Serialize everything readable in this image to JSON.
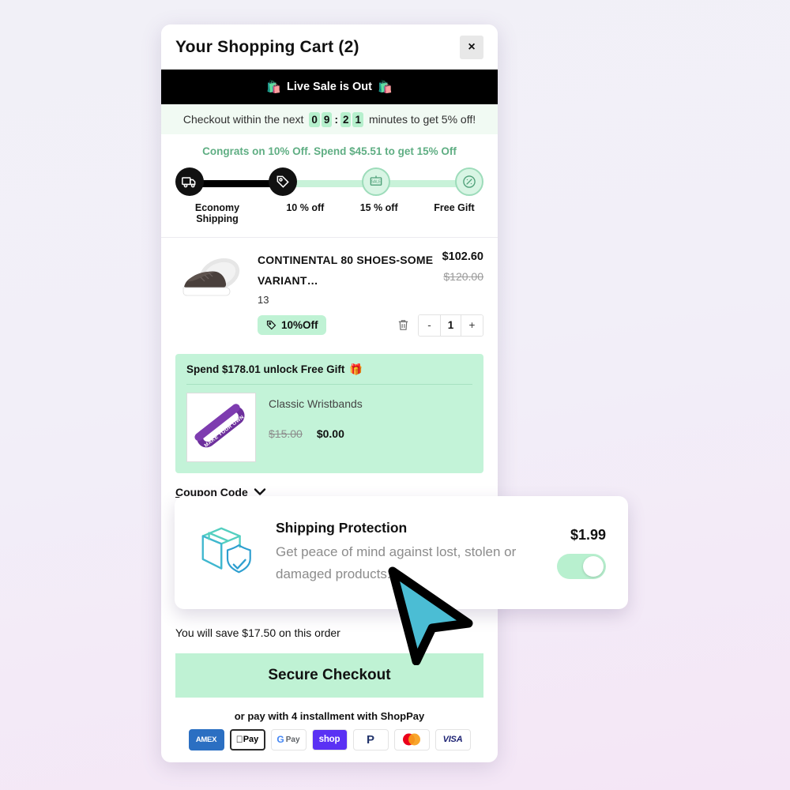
{
  "header": {
    "title": "Your Shopping Cart (2)",
    "close_icon": "close-icon",
    "close_label": "×"
  },
  "live_sale": {
    "label": "Live Sale is Out",
    "left_emoji": "🛍️",
    "right_emoji": "🛍️"
  },
  "timer": {
    "prefix": "Checkout within the next",
    "digits": [
      "0",
      "9",
      "2",
      "1"
    ],
    "separator": ":",
    "suffix": "minutes to get 5% off!",
    "value": "09:21"
  },
  "progress": {
    "congrats": "Congrats on 10% Off. Spend $45.51 to get 15% Off",
    "fill_percent": 38,
    "milestones": [
      {
        "label": "Economy Shipping",
        "icon": "truck-icon",
        "state": "done"
      },
      {
        "label": "10 % off",
        "icon": "tag-icon",
        "state": "done"
      },
      {
        "label": "15 % off",
        "icon": "sale-sign-icon",
        "state": "todo"
      },
      {
        "label": "Free Gift",
        "icon": "percent-badge-icon",
        "state": "todo"
      }
    ]
  },
  "product": {
    "name": "CONTINENTAL 80 SHOES-SOME VARIANT…",
    "variant": "13",
    "price_now": "$102.60",
    "price_was": "$120.00",
    "discount_badge": "10%Off",
    "discount_icon": "tag-icon",
    "delete_icon": "trash-icon",
    "qty_minus": "-",
    "qty_value": "1",
    "qty_plus": "+",
    "image_alt": "brown-sneaker-image"
  },
  "free_gift": {
    "heading": "Spend $178.01 unlock Free Gift",
    "heading_emoji": "🎁",
    "item_name": "Classic Wristbands",
    "price_was": "$15.00",
    "price_now": "$0.00",
    "image_text": "MAKE YOUR OWN",
    "image_alt": "purple-wristband-image"
  },
  "coupon": {
    "label": "Coupon Code",
    "chevron_icon": "chevron-down-icon"
  },
  "shipping_protection": {
    "title": "Shipping Protection",
    "description": "Get peace of mind against lost, stolen or damaged products.",
    "price": "$1.99",
    "icon": "package-shield-icon",
    "toggle_on": true
  },
  "footer": {
    "savings_text": "You will save $17.50 on this order",
    "checkout_label": "Secure Checkout",
    "installment_text": "or pay with 4 installment with ShopPay",
    "payment_methods": [
      {
        "name": "amex",
        "label": "AMEX"
      },
      {
        "name": "apple-pay",
        "label": "Pay"
      },
      {
        "name": "google-pay",
        "label": "Pay"
      },
      {
        "name": "shop-pay",
        "label": "shop"
      },
      {
        "name": "paypal",
        "label": "P"
      },
      {
        "name": "mastercard",
        "label": ""
      },
      {
        "name": "visa",
        "label": "VISA"
      }
    ]
  },
  "colors": {
    "accent_green": "#bff2d4",
    "accent_green_dark": "#5fae83",
    "black_bar": "#000000",
    "gift_bg": "#c3f3d8",
    "cursor": "#4bbdd4"
  },
  "cursor": {
    "icon": "mouse-pointer-icon"
  }
}
